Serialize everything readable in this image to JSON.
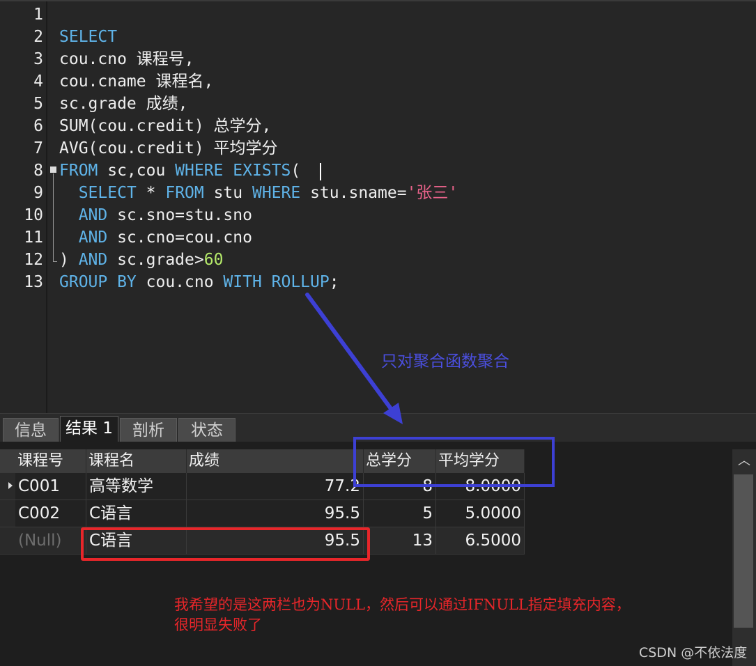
{
  "editor": {
    "line_numbers": [
      "1",
      "2",
      "3",
      "4",
      "5",
      "6",
      "7",
      "8",
      "9",
      "10",
      "11",
      "12",
      "13"
    ],
    "lines": [
      [],
      [
        {
          "t": "SELECT",
          "c": "kw"
        }
      ],
      [
        {
          "t": "cou.cno 课程号,",
          "c": ""
        }
      ],
      [
        {
          "t": "cou.cname 课程名,",
          "c": ""
        }
      ],
      [
        {
          "t": "sc.grade 成绩,",
          "c": ""
        }
      ],
      [
        {
          "t": "SUM(cou.credit) 总学分,",
          "c": ""
        }
      ],
      [
        {
          "t": "AVG(cou.credit) 平均学分",
          "c": ""
        }
      ],
      [
        {
          "t": "FROM",
          "c": "kw"
        },
        {
          "t": " sc,cou ",
          "c": ""
        },
        {
          "t": "WHERE",
          "c": "kw"
        },
        {
          "t": " ",
          "c": ""
        },
        {
          "t": "EXISTS",
          "c": "kw"
        },
        {
          "t": "(",
          "c": ""
        }
      ],
      [
        {
          "t": "  ",
          "c": ""
        },
        {
          "t": "SELECT",
          "c": "kw"
        },
        {
          "t": " * ",
          "c": ""
        },
        {
          "t": "FROM",
          "c": "kw"
        },
        {
          "t": " stu ",
          "c": ""
        },
        {
          "t": "WHERE",
          "c": "kw"
        },
        {
          "t": " stu.sname=",
          "c": ""
        },
        {
          "t": "'张三'",
          "c": "str"
        }
      ],
      [
        {
          "t": "  ",
          "c": ""
        },
        {
          "t": "AND",
          "c": "kw"
        },
        {
          "t": " sc.sno=stu.sno",
          "c": ""
        }
      ],
      [
        {
          "t": "  ",
          "c": ""
        },
        {
          "t": "AND",
          "c": "kw"
        },
        {
          "t": " sc.cno=cou.cno",
          "c": ""
        }
      ],
      [
        {
          "t": ") ",
          "c": ""
        },
        {
          "t": "AND",
          "c": "kw"
        },
        {
          "t": " sc.grade>",
          "c": ""
        },
        {
          "t": "60",
          "c": "num"
        }
      ],
      [
        {
          "t": "GROUP BY",
          "c": "kw"
        },
        {
          "t": " cou.cno ",
          "c": ""
        },
        {
          "t": "WITH ROLLUP",
          "c": "kw"
        },
        {
          "t": ";",
          "c": ""
        }
      ]
    ]
  },
  "tabs": {
    "info": "信息",
    "result": "结果 1",
    "profile": "剖析",
    "status": "状态"
  },
  "grid": {
    "columns": [
      "课程号",
      "课程名",
      "成绩",
      "总学分",
      "平均学分"
    ],
    "rows": [
      [
        "C001",
        "高等数学",
        "77.2",
        "8",
        "8.0000"
      ],
      [
        "C002",
        "C语言",
        "95.5",
        "5",
        "5.0000"
      ],
      [
        "(Null)",
        "C语言",
        "95.5",
        "13",
        "6.5000"
      ]
    ],
    "scroll_up_glyph": "︿"
  },
  "annotations": {
    "blue_note": "只对聚合函数聚合",
    "red_note_line1": "我希望的是这两栏也为NULL，然后可以通过IFNULL指定填充内容，",
    "red_note_line2": "很明显失败了",
    "blue_color": "#3d40d4",
    "red_color": "#e8262a"
  },
  "watermark": "CSDN @不依法度"
}
